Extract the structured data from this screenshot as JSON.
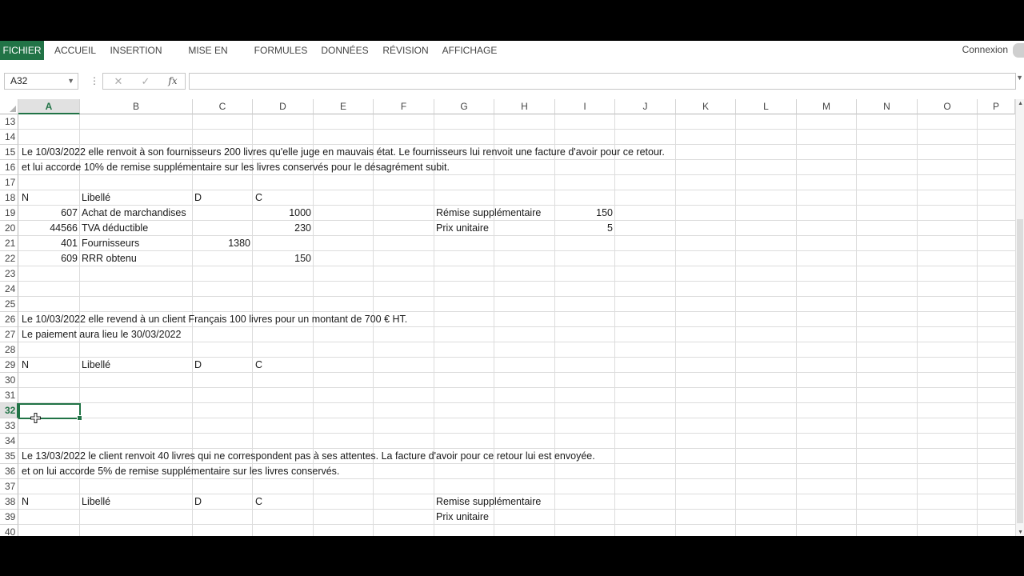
{
  "ribbon": {
    "tabs": [
      "FICHIER",
      "ACCUEIL",
      "INSERTION",
      "MISE EN PAGE",
      "FORMULES",
      "DONNÉES",
      "RÉVISION",
      "AFFICHAGE"
    ],
    "signin": "Connexion"
  },
  "formula_bar": {
    "name_box": "A32",
    "cancel_icon": "✕",
    "enter_icon": "✓",
    "fx_label": "fx",
    "formula": ""
  },
  "columns": [
    "A",
    "B",
    "C",
    "D",
    "E",
    "F",
    "G",
    "H",
    "I",
    "J",
    "K",
    "L",
    "M",
    "N",
    "O",
    "P"
  ],
  "selected_column": "A",
  "rows": [
    "13",
    "14",
    "15",
    "16",
    "17",
    "18",
    "19",
    "20",
    "21",
    "22",
    "23",
    "24",
    "25",
    "26",
    "27",
    "28",
    "29",
    "30",
    "31",
    "32",
    "33",
    "34",
    "35",
    "36",
    "37",
    "38",
    "39",
    "40"
  ],
  "selected_row": "32",
  "cells": {
    "r15": "Le 10/03/2022 elle renvoit à son fournisseurs 200 livres qu'elle juge en mauvais état. Le fournisseurs lui renvoit une facture d'avoir pour ce retour.",
    "r16": "et lui accorde 10% de remise supplémentaire sur les livres conservés pour le désagrément subit.",
    "r18": {
      "a": "N",
      "b": "Libellé",
      "c": "D",
      "d": "C"
    },
    "r19": {
      "a": "607",
      "b": "Achat de marchandises",
      "d": "1000",
      "g": "Rémise supplémentaire",
      "i": "150"
    },
    "r20": {
      "a": "44566",
      "b": "TVA déductible",
      "d": "230",
      "g": "Prix unitaire",
      "i": "5"
    },
    "r21": {
      "a": "401",
      "b": "Fournisseurs",
      "c": "1380"
    },
    "r22": {
      "a": "609",
      "b": "RRR obtenu",
      "d": "150"
    },
    "r26": "Le 10/03/2022 elle revend à un client Français 100 livres pour un montant de 700 € HT.",
    "r27": "Le paiement aura lieu le 30/03/2022",
    "r29": {
      "a": "N",
      "b": "Libellé",
      "c": "D",
      "d": "C"
    },
    "r35": "Le 13/03/2022 le client renvoit 40 livres qui ne correspondent pas à ses attentes. La facture d'avoir pour ce retour lui est envoyée.",
    "r36": "et on lui accorde 5% de remise supplémentaire sur les livres conservés.",
    "r38": {
      "a": "N",
      "b": "Libellé",
      "c": "D",
      "d": "C",
      "g": "Remise supplémentaire"
    },
    "r39": {
      "g": "Prix unitaire"
    }
  },
  "colors": {
    "accent": "#217346"
  }
}
